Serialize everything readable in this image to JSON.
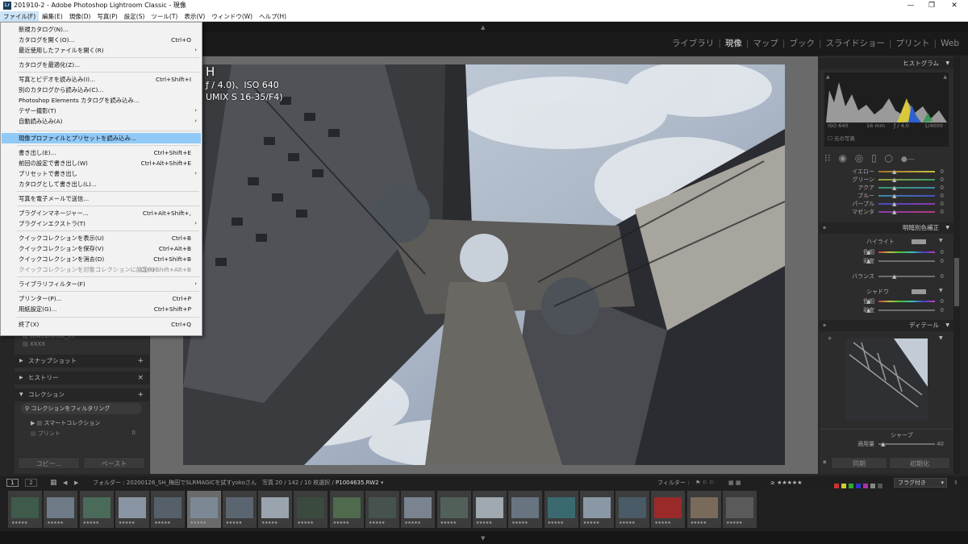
{
  "window": {
    "title": "201910-2 - Adobe Photoshop Lightroom Classic - 現像",
    "app_icon": "Lr",
    "minimize": "—",
    "maximize": "❐",
    "close": "✕"
  },
  "menubar": [
    "ファイル(F)",
    "編集(E)",
    "現像(D)",
    "写真(P)",
    "設定(S)",
    "ツール(T)",
    "表示(V)",
    "ウィンドウ(W)",
    "ヘルプ(H)"
  ],
  "modules": [
    "ライブラリ",
    "現像",
    "マップ",
    "ブック",
    "スライドショー",
    "プリント",
    "Web"
  ],
  "file_menu": [
    {
      "label": "新規カタログ(N)...",
      "shortcut": "",
      "arrow": ""
    },
    {
      "label": "カタログを開く(O)...",
      "shortcut": "Ctrl+O",
      "arrow": ""
    },
    {
      "label": "最近使用したファイルを開く(R)",
      "shortcut": "",
      "arrow": "›"
    },
    {
      "label": "カタログを最適化(Z)...",
      "shortcut": "",
      "arrow": ""
    },
    {
      "label": "写真とビデオを読み込み(I)...",
      "shortcut": "Ctrl+Shift+I",
      "arrow": ""
    },
    {
      "label": "別のカタログから読み込み(C)...",
      "shortcut": "",
      "arrow": ""
    },
    {
      "label": "Photoshop Elements カタログを読み込み...",
      "shortcut": "",
      "arrow": ""
    },
    {
      "label": "テザー撮影(T)",
      "shortcut": "",
      "arrow": "›"
    },
    {
      "label": "自動読み込み(A)",
      "shortcut": "",
      "arrow": "›"
    },
    {
      "label": "現像プロファイルとプリセットを読み込み...",
      "shortcut": "",
      "arrow": ""
    },
    {
      "label": "書き出し(E)...",
      "shortcut": "Ctrl+Shift+E",
      "arrow": ""
    },
    {
      "label": "前回の設定で書き出し(W)",
      "shortcut": "Ctrl+Alt+Shift+E",
      "arrow": ""
    },
    {
      "label": "プリセットで書き出し",
      "shortcut": "",
      "arrow": "›"
    },
    {
      "label": "カタログとして書き出し(L)...",
      "shortcut": "",
      "arrow": ""
    },
    {
      "label": "写真を電子メールで送信...",
      "shortcut": "",
      "arrow": ""
    },
    {
      "label": "プラグインマネージャー...",
      "shortcut": "Ctrl+Alt+Shift+,",
      "arrow": ""
    },
    {
      "label": "プラグインエクストラ(T)",
      "shortcut": "",
      "arrow": "›"
    },
    {
      "label": "クイックコレクションを表示(U)",
      "shortcut": "Ctrl+B",
      "arrow": ""
    },
    {
      "label": "クイックコレクションを保存(V)",
      "shortcut": "Ctrl+Alt+B",
      "arrow": ""
    },
    {
      "label": "クイックコレクションを消去(D)",
      "shortcut": "Ctrl+Shift+B",
      "arrow": ""
    },
    {
      "label": "クイックコレクションを対象コレクションに設定(Q)",
      "shortcut": "Ctrl+Shift+Alt+B",
      "arrow": ""
    },
    {
      "label": "ライブラリフィルター(F)",
      "shortcut": "",
      "arrow": "›"
    },
    {
      "label": "プリンター(P)...",
      "shortcut": "Ctrl+P",
      "arrow": ""
    },
    {
      "label": "用紙設定(G)...",
      "shortcut": "Ctrl+Shift+P",
      "arrow": ""
    },
    {
      "label": "終了(X)",
      "shortcut": "Ctrl+Q",
      "arrow": ""
    }
  ],
  "photo_overlay": {
    "line1": "H",
    "line2": "ƒ / 4.0)、ISO 640",
    "line3": "UMIX S 16-35/F4)"
  },
  "left_panel": {
    "preset_items": [
      "LowContrast_05",
      "XXXX"
    ],
    "snapshot": "スナップショット",
    "history": "ヒストリー",
    "collections": "コレクション",
    "filter_collections": "コレクションをフィルタリング",
    "smart_collection": "スマートコレクション",
    "print": "プリント",
    "print_count": "0",
    "copy": "コピー...",
    "paste": "ペースト"
  },
  "right_panel": {
    "histogram": "ヒストグラム",
    "exif": {
      "iso": "ISO 640",
      "focal": "16 mm",
      "aperture": "ƒ / 4.0",
      "shutter": "1/4000"
    },
    "original_photo": "元の写真",
    "hsl": [
      {
        "label": "イエロー",
        "value": "0"
      },
      {
        "label": "グリーン",
        "value": "0"
      },
      {
        "label": "アクア",
        "value": "0"
      },
      {
        "label": "ブルー",
        "value": "0"
      },
      {
        "label": "パープル",
        "value": "0"
      },
      {
        "label": "マゼンタ",
        "value": "0"
      }
    ],
    "split_toning": "明暗別色補正",
    "highlight": "ハイライト",
    "hue": "色相",
    "saturation": "彩度",
    "balance": "バランス",
    "shadow": "シャドウ",
    "zero": "0",
    "detail": "ディテール",
    "sharpen": "シャープ",
    "amount": "適用量",
    "amount_value": "40",
    "sync": "同期",
    "reset": "初期化"
  },
  "toolbar": {
    "view1": "1",
    "view2": "2",
    "path": "フォルダー : 20200126_SH_梅田でSLRMAGICを試すyokoさん　写真 20 / 142 / 10 枚選択 /",
    "filename": "P1004635.RW2",
    "filter_label": "フィルター :",
    "rating_filter": "≥ ★★★★★",
    "flag_select": "フラグ付き"
  },
  "filmstrip": {
    "cells": 21,
    "stars": "★★★★★"
  },
  "colors": {
    "menu_highlight": "#91c9f7",
    "panel_bg": "#2c2c2c",
    "center_bg": "#6a6a6a"
  }
}
